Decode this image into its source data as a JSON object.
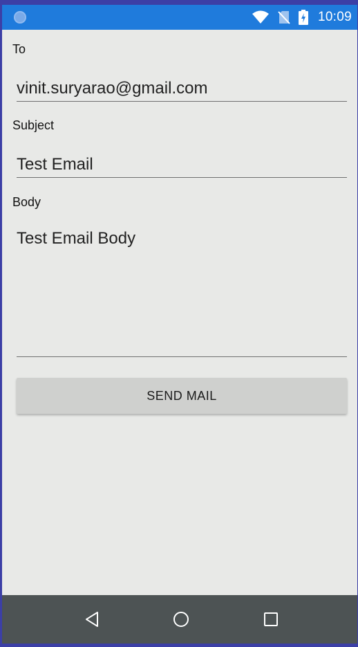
{
  "status_bar": {
    "time": "10:09",
    "color": "#1f7bdc"
  },
  "form": {
    "to_label": "To",
    "to_value": "vinit.suryarao@gmail.com",
    "subject_label": "Subject",
    "subject_value": "Test Email",
    "body_label": "Body",
    "body_value": "Test Email Body",
    "send_button_label": "SEND MAIL"
  },
  "nav_bar": {
    "buttons": [
      "back-icon",
      "home-icon",
      "recents-icon"
    ],
    "color": "#4d5354"
  }
}
